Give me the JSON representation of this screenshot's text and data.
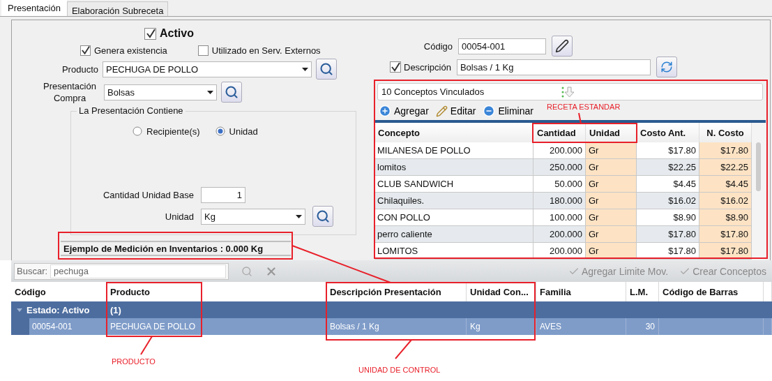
{
  "tabs": [
    {
      "label": "Presentación",
      "selected": true
    },
    {
      "label": "Elaboración Subreceta",
      "selected": false
    }
  ],
  "form": {
    "activo": {
      "label": "Activo",
      "checked": true
    },
    "genera": {
      "label": "Genera existencia",
      "checked": true
    },
    "externos": {
      "label": "Utilizado en Serv. Externos",
      "checked": false
    },
    "producto": {
      "label": "Producto",
      "value": "PECHUGA DE POLLO"
    },
    "presentacion": {
      "label": "Presentación Compra",
      "value": "Bolsas"
    },
    "group_title": "La Presentación Contiene",
    "radios": [
      {
        "label": "Recipiente(s)",
        "selected": false
      },
      {
        "label": "Unidad",
        "selected": true
      }
    ],
    "cantidad": {
      "label": "Cantidad Unidad Base",
      "value": "1"
    },
    "unidad": {
      "label": "Unidad",
      "value": "Kg"
    },
    "ejemplo": "Ejemplo de Medición en Inventarios :  0.000 Kg"
  },
  "codigo": {
    "label": "Código",
    "value": "00054-001"
  },
  "descripcion": {
    "label": "Descripción",
    "checked": true,
    "value": "Bolsas / 1 Kg"
  },
  "conceptos": {
    "title": "10  Conceptos Vinculados",
    "toolbar": [
      "Agregar",
      "Editar",
      "Eliminar"
    ],
    "columns": [
      "Concepto",
      "Cantidad",
      "Unidad",
      "Costo Ant.",
      "N. Costo"
    ],
    "rows": [
      [
        "MILANESA DE POLLO",
        "200.000",
        "Gr",
        "$17.80",
        "$17.80"
      ],
      [
        "lomitos",
        "250.000",
        "Gr",
        "$22.25",
        "$22.25"
      ],
      [
        "CLUB SANDWICH",
        "50.000",
        "Gr",
        "$4.45",
        "$4.45"
      ],
      [
        "Chilaquiles.",
        "180.000",
        "Gr",
        "$16.02",
        "$16.02"
      ],
      [
        "CON POLLO",
        "100.000",
        "Gr",
        "$8.90",
        "$8.90"
      ],
      [
        "perro caliente",
        "200.000",
        "Gr",
        "$17.80",
        "$17.80"
      ],
      [
        "LOMITOS",
        "200.000",
        "Gr",
        "$17.80",
        "$17.80"
      ]
    ]
  },
  "search": {
    "label": "Buscar:",
    "value": "pechuga"
  },
  "actions": [
    "Agregar Limite Mov.",
    "Crear Conceptos"
  ],
  "grid": {
    "columns": [
      "Código",
      "Producto",
      "Descripción Presentación",
      "Unidad Con...",
      "Familia",
      "L.M.",
      "Código de Barras"
    ],
    "group": {
      "label": "Estado: Activo",
      "count": "(1)"
    },
    "rows": [
      {
        "cells": [
          "00054-001",
          "PECHUGA DE POLLO",
          "Bolsas / 1 Kg",
          "Kg",
          "AVES",
          "30",
          ""
        ],
        "selected": true
      }
    ]
  },
  "annotations": [
    "RECETA ESTANDAR",
    "PRODUCTO",
    "UNIDAD DE CONTROL"
  ]
}
